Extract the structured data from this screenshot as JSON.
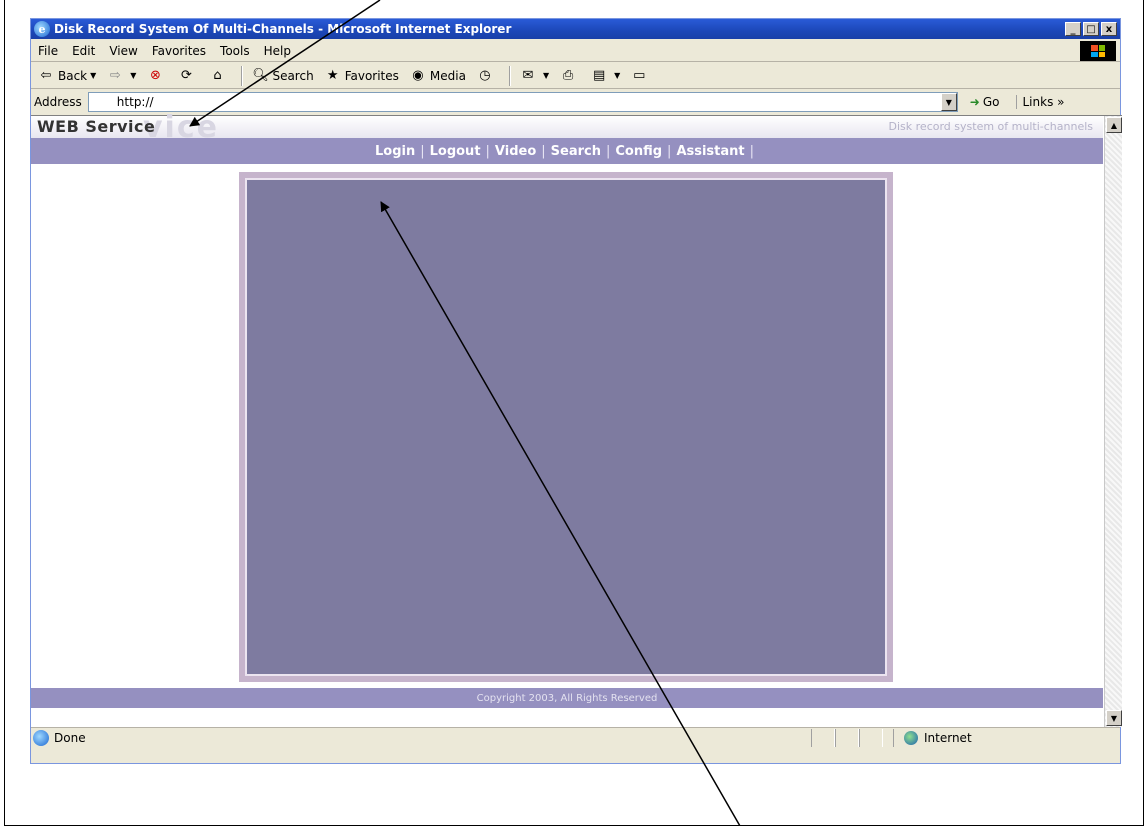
{
  "window": {
    "title": "Disk Record System Of Multi-Channels - Microsoft Internet Explorer",
    "minimize": "_",
    "maximize": "□",
    "close": "x"
  },
  "menubar": {
    "items": [
      "File",
      "Edit",
      "View",
      "Favorites",
      "Tools",
      "Help"
    ]
  },
  "toolbar": {
    "back_label": "Back",
    "search_label": "Search",
    "favorites_label": "Favorites",
    "media_label": "Media"
  },
  "addressbar": {
    "label": "Address",
    "url": "http://",
    "go_label": "Go",
    "links_label": "Links »"
  },
  "page": {
    "brand": "WEB Service",
    "brand_ghost": "vice",
    "tagline": "Disk record system of multi-channels",
    "nav": [
      "Login",
      "Logout",
      "Video",
      "Search",
      "Config",
      "Assistant"
    ],
    "footer": "Copyright 2003,  All Rights Reserved"
  },
  "statusbar": {
    "status": "Done",
    "zone": "Internet"
  },
  "colors": {
    "nav_bar": "#9590c0",
    "content_panel": "#7e7ba0",
    "panel_border": "#c6b4cc",
    "titlebar": "#1c47b8"
  }
}
